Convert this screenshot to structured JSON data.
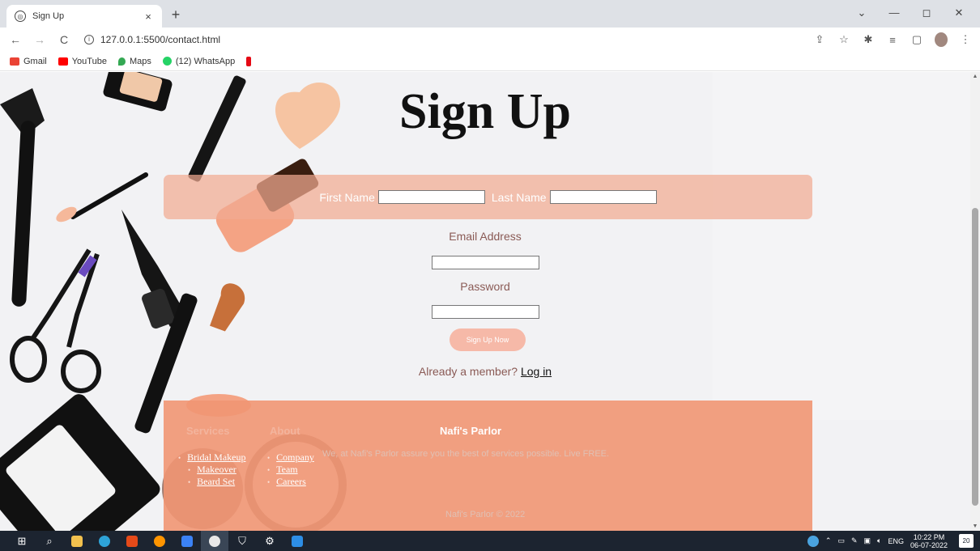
{
  "browser": {
    "tab_title": "Sign Up",
    "tab_close": "×",
    "new_tab": "+",
    "url": "127.0.0.1:5500/contact.html",
    "window_controls": [
      "⌄",
      "—",
      "◻",
      "✕"
    ],
    "bookmarks": [
      {
        "label": "Gmail",
        "color": "#EA4335"
      },
      {
        "label": "YouTube",
        "color": "#FF0000"
      },
      {
        "label": "Maps",
        "color": "#34A853"
      },
      {
        "label": "(12) WhatsApp",
        "color": "#25D366"
      },
      {
        "label": "",
        "color": "#E50914"
      }
    ]
  },
  "page": {
    "title": "Sign Up",
    "first_name_label": "First Name",
    "last_name_label": "Last Name",
    "email_label": "Email Address",
    "password_label": "Password",
    "signup_button": "Sign Up Now",
    "member_prompt": "Already a member?",
    "login_link": "Log in"
  },
  "footer": {
    "services_heading": "Services",
    "services": [
      "Bridal Makeup",
      "Makeover",
      "Beard Set"
    ],
    "about_heading": "About",
    "about": [
      "Company",
      "Team",
      "Careers"
    ],
    "brand_heading": "Nafi's Parlor",
    "brand_text": "We, at Nafi's Parlor assure you the best of services possible. Live FREE.",
    "copyright": "Nafi's Parlor © 2022"
  },
  "taskbar": {
    "lang": "ENG",
    "time": "10:22 PM",
    "date": "06-07-2022",
    "notifications": "20"
  },
  "colors": {
    "accent_band": "#F1AB92",
    "footer_bg": "#F19673",
    "button_bg": "#F6B9A8"
  }
}
